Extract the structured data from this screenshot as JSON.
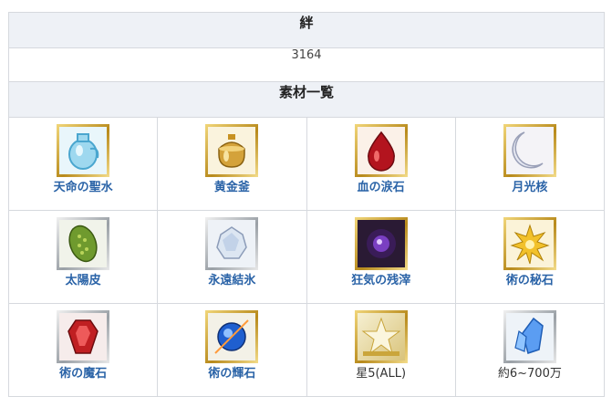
{
  "bond": {
    "header": "絆",
    "value": "3164"
  },
  "materials": {
    "header": "素材一覧",
    "items": [
      {
        "label": "天命の聖水",
        "icon": "holy-water-vase-icon",
        "frame": "gold",
        "link": true
      },
      {
        "label": "黄金釜",
        "icon": "golden-cauldron-icon",
        "frame": "gold",
        "link": true
      },
      {
        "label": "血の涙石",
        "icon": "blood-tear-stone-icon",
        "frame": "gold",
        "link": true
      },
      {
        "label": "月光核",
        "icon": "moonlight-core-icon",
        "frame": "gold",
        "link": true
      },
      {
        "label": "太陽皮",
        "icon": "sun-skin-icon",
        "frame": "silver",
        "link": true
      },
      {
        "label": "永遠結氷",
        "icon": "eternal-ice-icon",
        "frame": "silver",
        "link": true
      },
      {
        "label": "狂気の残滓",
        "icon": "madness-remnant-icon",
        "frame": "gold",
        "link": true
      },
      {
        "label": "術の秘石",
        "icon": "magic-secret-gem-icon",
        "frame": "gold",
        "link": true
      },
      {
        "label": "術の魔石",
        "icon": "magic-magic-gem-icon",
        "frame": "silver",
        "link": true
      },
      {
        "label": "術の輝石",
        "icon": "magic-gem-icon",
        "frame": "gold",
        "link": true
      },
      {
        "label": "星5(ALL)",
        "icon": "star5-craft-essence-icon",
        "frame": "gold",
        "link": false
      },
      {
        "label": "約6~700万",
        "icon": "qp-crystal-icon",
        "frame": "silver",
        "link": false
      }
    ]
  }
}
